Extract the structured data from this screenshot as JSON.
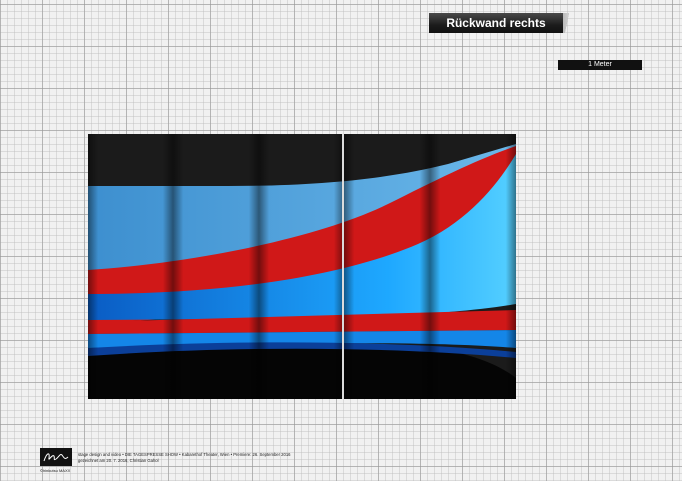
{
  "header": {
    "title": "Rückwand rechts"
  },
  "scale": {
    "label": "1 Meter"
  },
  "artwork": {
    "panels": 5,
    "colors": {
      "black": "#1a1a1a",
      "red": "#d01818",
      "light_blue": "#4ea6dc",
      "bright_blue": "#1aa0ff",
      "dark_blue": "#0f52b8"
    }
  },
  "footer": {
    "logo_caption": "©hinkutsu MAXX",
    "line1": "stage design and video • DIE TAGESPRESSE SHOW • Kabarethof Theater, Wien • Premiere: 26. September 2016",
    "line2": "gezeichnet am 20. 7. 2016, Christian Gahol"
  }
}
